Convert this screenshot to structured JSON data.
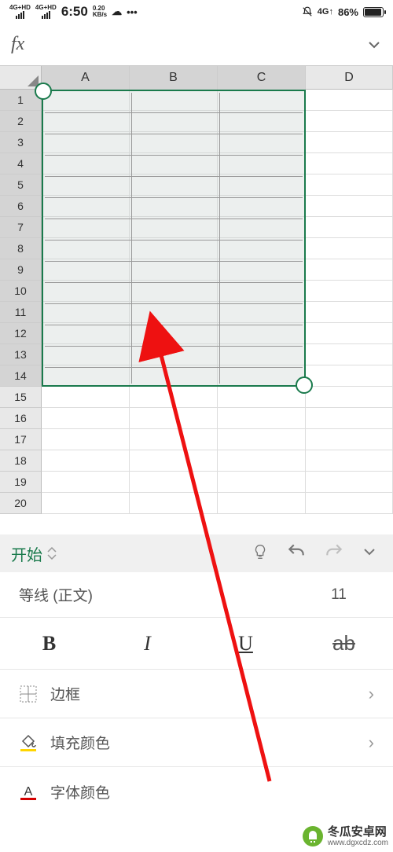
{
  "status": {
    "net1": "4G+HD",
    "net2": "4G+HD",
    "time": "6:50",
    "speed": "0.20",
    "speed_unit": "KB/s",
    "net_label": "4G↑",
    "battery_pct": "86%"
  },
  "formula": {
    "fx": "fx"
  },
  "columns": [
    "A",
    "B",
    "C",
    "D"
  ],
  "rows": [
    "1",
    "2",
    "3",
    "4",
    "5",
    "6",
    "7",
    "8",
    "9",
    "10",
    "11",
    "12",
    "13",
    "14",
    "15",
    "16",
    "17",
    "18",
    "19",
    "20"
  ],
  "toolbar": {
    "tab": "开始"
  },
  "panel": {
    "font_name": "等线 (正文)",
    "font_size": "11",
    "bold": "B",
    "italic": "I",
    "underline": "U",
    "strike": "ab",
    "border": "边框",
    "fill": "填充颜色",
    "font_color": "字体颜色"
  },
  "watermark": {
    "text": "冬瓜安卓网",
    "url": "www.dgxcdz.com"
  }
}
